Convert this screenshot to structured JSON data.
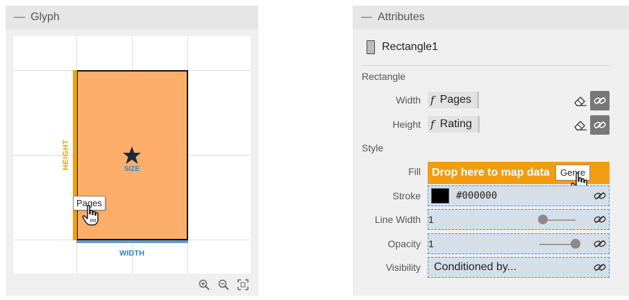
{
  "glyph_panel": {
    "title": "Glyph",
    "collapse_glyph": "—",
    "height_label": "HEIGHT",
    "width_label": "WIDTH",
    "size_label": "SIZE",
    "drag_chip": "Pages"
  },
  "attributes_panel": {
    "title": "Attributes",
    "collapse_glyph": "—",
    "element_name": "Rectangle1",
    "section_rectangle": "Rectangle",
    "width": {
      "label": "Width",
      "fx": "f",
      "value": "Pages"
    },
    "height": {
      "label": "Height",
      "fx": "f",
      "value": "Rating"
    },
    "section_style": "Style",
    "fill": {
      "label": "Fill",
      "drop_text": "Drop here to map data",
      "drag_chip": "Genre"
    },
    "stroke": {
      "label": "Stroke",
      "value": "#000000",
      "color": "#000000"
    },
    "line_width": {
      "label": "Line Width",
      "value": "1",
      "slider_fraction": 0.1
    },
    "opacity": {
      "label": "Opacity",
      "value": "1",
      "slider_fraction": 1.0
    },
    "visibility": {
      "label": "Visibility",
      "value": "Conditioned by..."
    }
  },
  "colors": {
    "rect_fill": "#fdae6b",
    "accent_orange": "#f39c12",
    "accent_blue": "#2e86c9"
  },
  "icons": [
    "zoom-in-icon",
    "zoom-out-icon",
    "fit-view-icon",
    "eraser-icon",
    "unlink-icon",
    "hand-cursor-icon",
    "star-icon",
    "rectangle-icon"
  ]
}
